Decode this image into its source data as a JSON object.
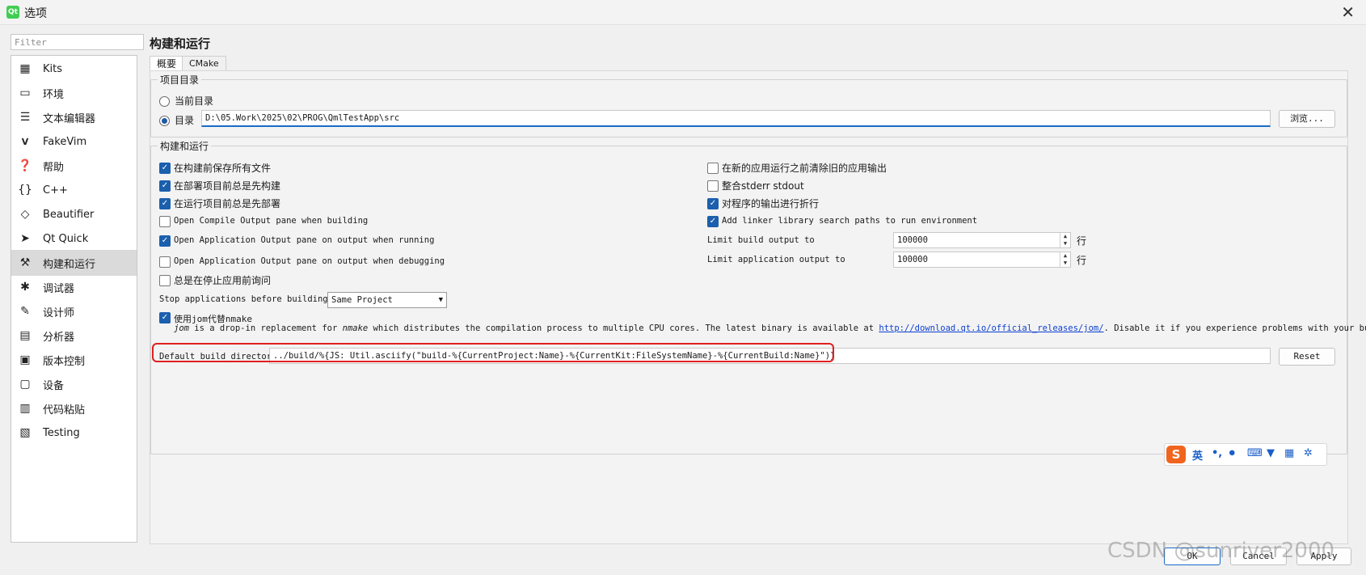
{
  "window": {
    "icon_text": "Qt",
    "title": "选项",
    "close_label": "✕"
  },
  "filter": {
    "placeholder": "Filter"
  },
  "sidebar": {
    "items": [
      {
        "label": "Kits",
        "icon": "kits-icon"
      },
      {
        "label": "环境",
        "icon": "monitor-icon"
      },
      {
        "label": "文本编辑器",
        "icon": "text-editor-icon"
      },
      {
        "label": "FakeVim",
        "icon": "fakevim-icon"
      },
      {
        "label": "帮助",
        "icon": "help-icon"
      },
      {
        "label": "C++",
        "icon": "braces-icon"
      },
      {
        "label": "Beautifier",
        "icon": "diamond-icon"
      },
      {
        "label": "Qt Quick",
        "icon": "paper-plane-icon"
      },
      {
        "label": "构建和运行",
        "icon": "hammer-icon",
        "active": true
      },
      {
        "label": "调试器",
        "icon": "bug-icon"
      },
      {
        "label": "设计师",
        "icon": "pencil-icon"
      },
      {
        "label": "分析器",
        "icon": "analyzer-icon"
      },
      {
        "label": "版本控制",
        "icon": "version-control-icon"
      },
      {
        "label": "设备",
        "icon": "device-icon"
      },
      {
        "label": "代码粘贴",
        "icon": "code-paste-icon"
      },
      {
        "label": "Testing",
        "icon": "testing-icon"
      }
    ]
  },
  "page": {
    "title": "构建和运行",
    "tabs": [
      "概要",
      "CMake"
    ]
  },
  "project_dir": {
    "title": "项目目录",
    "current_dir_label": "当前目录",
    "dir_label": "目录",
    "dir_value": "D:\\05.Work\\2025\\02\\PROG\\QmlTestApp\\src",
    "browse_label": "浏览..."
  },
  "build_run": {
    "title": "构建和运行",
    "left_checks": [
      {
        "label": "在构建前保存所有文件",
        "checked": true
      },
      {
        "label": "在部署项目前总是先构建",
        "checked": true
      },
      {
        "label": "在运行项目前总是先部署",
        "checked": true
      },
      {
        "label": "Open Compile Output pane when building",
        "checked": false
      },
      {
        "label": "Open Application Output pane on output when running",
        "checked": true
      },
      {
        "label": "Open Application Output pane on output when debugging",
        "checked": false
      },
      {
        "label": "总是在停止应用前询问",
        "checked": false
      }
    ],
    "right_checks": [
      {
        "label": "在新的应用运行之前清除旧的应用输出",
        "checked": false
      },
      {
        "label": "整合stderr stdout",
        "checked": false
      },
      {
        "label": "对程序的输出进行折行",
        "checked": true
      },
      {
        "label": "Add linker library search paths to run environment",
        "checked": true
      }
    ],
    "limit_build_label": "Limit build output to",
    "limit_build_value": "100000",
    "limit_app_label": "Limit application output to",
    "limit_app_value": "100000",
    "unit_label": "行",
    "stop_apps_label": "Stop applications before building:",
    "stop_apps_value": "Same Project",
    "jom_label": "使用jom代替nmake",
    "jom_desc_1": "jom",
    "jom_desc_2": " is a drop-in replacement for ",
    "jom_desc_3": "nmake",
    "jom_desc_4": " which distributes the compilation process to multiple CPU cores. The latest binary is available at ",
    "jom_link": "http://download.qt.io/official_releases/jom/",
    "jom_desc_5": ". Disable it if you experience problems with your builds.",
    "default_build_dir_label": "Default build directory:",
    "default_build_dir_value": "../build/%{JS: Util.asciify(\"build-%{CurrentProject:Name}-%{CurrentKit:FileSystemName}-%{CurrentBuild:Name}\")}",
    "reset_label": "Reset"
  },
  "ime_toolbar": {
    "logo": "S",
    "mode": "英",
    "items": [
      "punct-icon",
      "mic-icon",
      "keyboard-icon",
      "skin-icon",
      "toolbox-icon",
      "settings-icon"
    ]
  },
  "footer": {
    "ok_label": "OK",
    "cancel_label": "Cancel",
    "apply_label": "Apply"
  },
  "watermark": "CSDN @sunriver2000",
  "colors": {
    "accent": "#1b5fad",
    "highlight": "#e01f1f",
    "sidebar_active": "#dadada"
  }
}
